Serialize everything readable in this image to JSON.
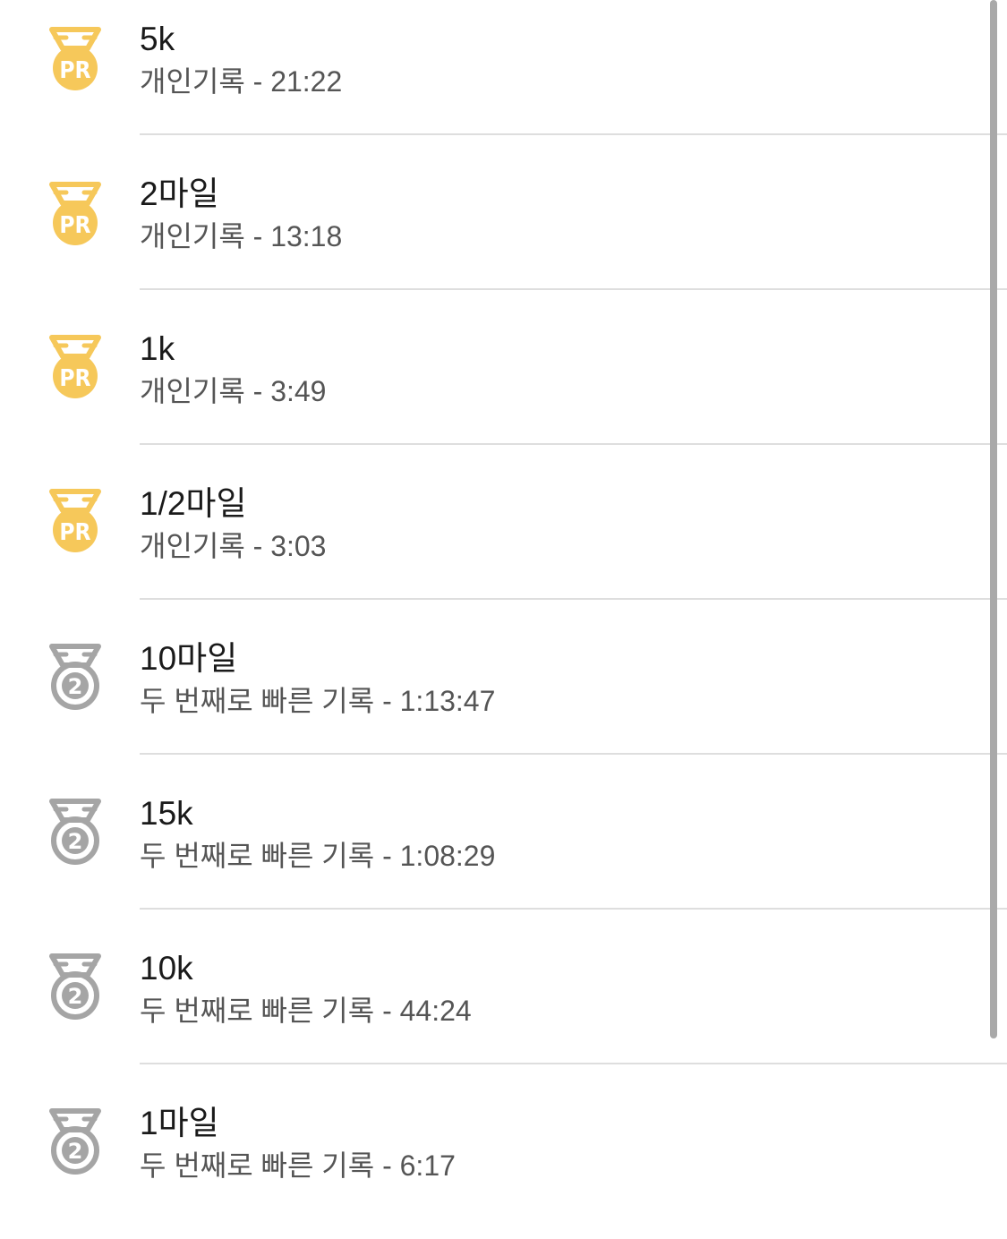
{
  "colors": {
    "gold_medal": "#f6c85a",
    "silver_medal": "#a5a5a5",
    "title_text": "#1a1a1a",
    "subtitle_text": "#555555",
    "divider": "#dedede",
    "scrollbar": "#a9a9a9"
  },
  "records": [
    {
      "icon": "pr-medal-icon",
      "badge_text": "PR",
      "title": "5k",
      "subtitle": "개인기록 - 21:22"
    },
    {
      "icon": "pr-medal-icon",
      "badge_text": "PR",
      "title": "2마일",
      "subtitle": "개인기록 - 13:18"
    },
    {
      "icon": "pr-medal-icon",
      "badge_text": "PR",
      "title": "1k",
      "subtitle": "개인기록 - 3:49"
    },
    {
      "icon": "pr-medal-icon",
      "badge_text": "PR",
      "title": "1/2마일",
      "subtitle": "개인기록 - 3:03"
    },
    {
      "icon": "second-place-medal-icon",
      "badge_text": "2",
      "title": "10마일",
      "subtitle": "두 번째로 빠른 기록 - 1:13:47"
    },
    {
      "icon": "second-place-medal-icon",
      "badge_text": "2",
      "title": "15k",
      "subtitle": "두 번째로 빠른 기록 - 1:08:29"
    },
    {
      "icon": "second-place-medal-icon",
      "badge_text": "2",
      "title": "10k",
      "subtitle": "두 번째로 빠른 기록 - 44:24"
    },
    {
      "icon": "second-place-medal-icon",
      "badge_text": "2",
      "title": "1마일",
      "subtitle": "두 번째로 빠른 기록 - 6:17"
    }
  ]
}
